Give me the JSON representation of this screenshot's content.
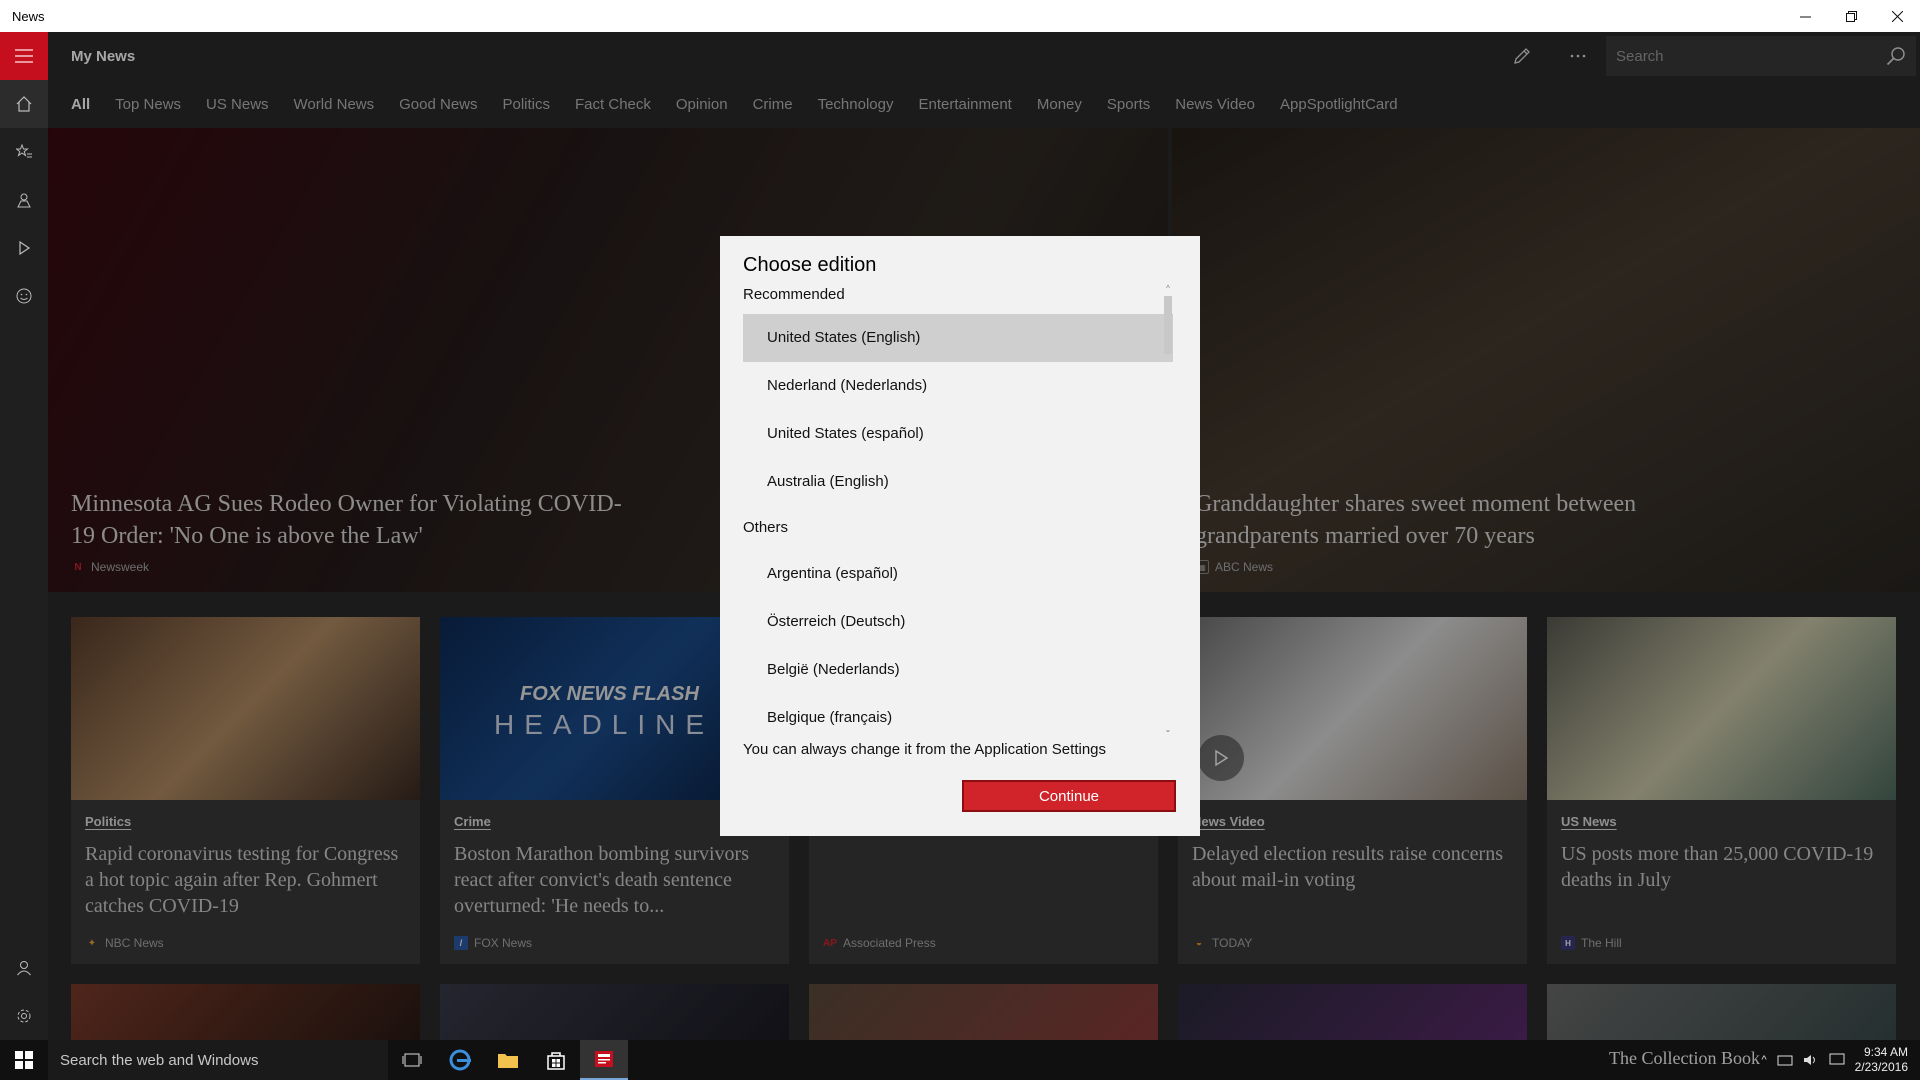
{
  "window": {
    "title": "News"
  },
  "header": {
    "title": "My News",
    "search_placeholder": "Search"
  },
  "tabs": [
    {
      "label": "All",
      "active": true
    },
    {
      "label": "Top News"
    },
    {
      "label": "US News"
    },
    {
      "label": "World News"
    },
    {
      "label": "Good News"
    },
    {
      "label": "Politics"
    },
    {
      "label": "Fact Check"
    },
    {
      "label": "Opinion"
    },
    {
      "label": "Crime"
    },
    {
      "label": "Technology"
    },
    {
      "label": "Entertainment"
    },
    {
      "label": "Money"
    },
    {
      "label": "Sports"
    },
    {
      "label": "News Video"
    },
    {
      "label": "AppSpotlightCard"
    }
  ],
  "hero": [
    {
      "title": "Minnesota AG Sues Rodeo Owner for Violating COVID-19 Order: 'No One is above the Law'",
      "source": "Newsweek"
    },
    {
      "title": "Granddaughter shares sweet moment between grandparents married over 70 years",
      "source": "ABC News"
    }
  ],
  "cards": [
    {
      "category": "Politics",
      "title": "Rapid coronavirus testing for Congress a hot topic again after Rep. Gohmert catches COVID-19",
      "source": "NBC News"
    },
    {
      "category": "Crime",
      "title": "Boston Marathon bombing survivors react after convict's death sentence overturned: 'He needs to...",
      "source": "FOX News",
      "image_text_1": "FOX NEWS FLASH",
      "image_text_2": "HEADLINE"
    },
    {
      "category": "",
      "title": "",
      "source": "Associated Press"
    },
    {
      "category": "News Video",
      "title": "Delayed election results raise concerns about mail-in voting",
      "source": "TODAY"
    },
    {
      "category": "US News",
      "title": "US posts more than 25,000 COVID-19 deaths in July",
      "source": "The Hill"
    }
  ],
  "dialog": {
    "title": "Choose edition",
    "recommended_label": "Recommended",
    "others_label": "Others",
    "recommended": [
      "United States (English)",
      "Nederland (Nederlands)",
      "United States (español)",
      "Australia (English)"
    ],
    "others": [
      "Argentina (español)",
      "Österreich (Deutsch)",
      "België (Nederlands)",
      "Belgique (français)"
    ],
    "selected": "United States (English)",
    "footer": "You can always change it from the Application Settings",
    "continue_label": "Continue"
  },
  "taskbar": {
    "search_placeholder": "Search the web and Windows",
    "time": "9:34 AM",
    "date": "2/23/2016",
    "watermark": "The Collection Book"
  },
  "colors": {
    "accent": "#d1232a",
    "rail": "#1f1f1f",
    "dialog_bg": "#f2f2f2"
  }
}
